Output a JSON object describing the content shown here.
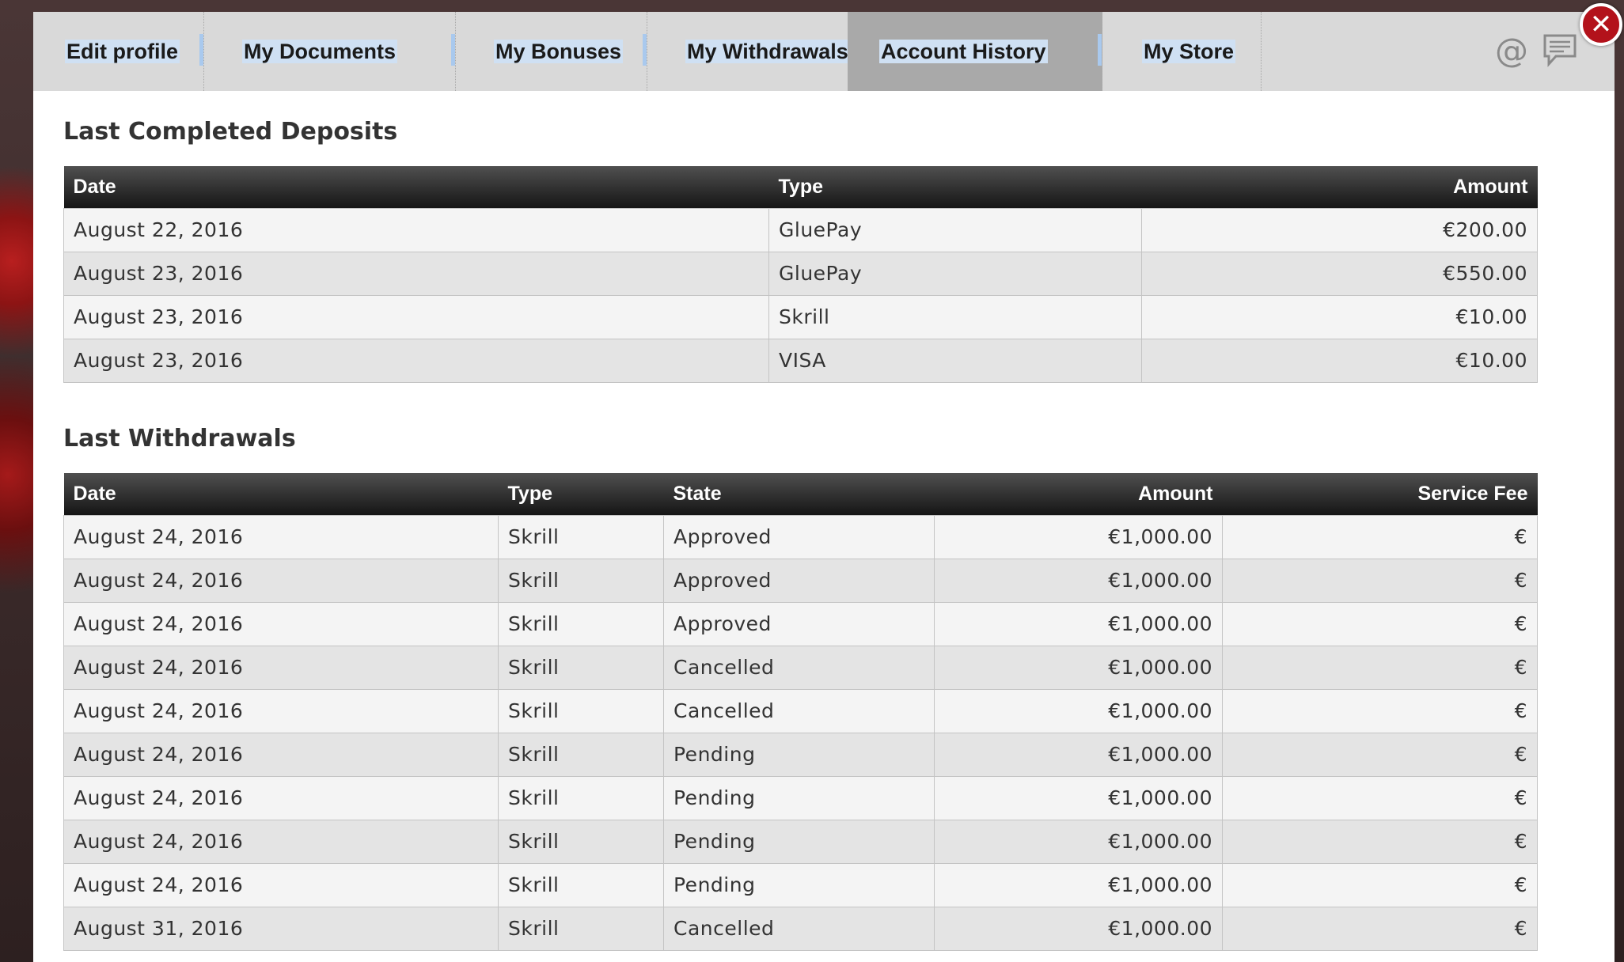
{
  "tabs": [
    {
      "label": "Edit profile",
      "active": false
    },
    {
      "label": "My Documents",
      "active": false
    },
    {
      "label": "My Bonuses",
      "active": false
    },
    {
      "label": "My Withdrawals",
      "active": false
    },
    {
      "label": "Account History",
      "active": true
    },
    {
      "label": "My Store",
      "active": false
    }
  ],
  "header_icons": {
    "at": "at-icon",
    "chat": "chat-bubble-icon",
    "close": "close-icon"
  },
  "deposits": {
    "title": "Last Completed Deposits",
    "columns": [
      "Date",
      "Type",
      "Amount"
    ],
    "rows": [
      {
        "date": "August 22, 2016",
        "type": "GluePay",
        "amount": "€200.00"
      },
      {
        "date": "August 23, 2016",
        "type": "GluePay",
        "amount": "€550.00"
      },
      {
        "date": "August 23, 2016",
        "type": "Skrill",
        "amount": "€10.00"
      },
      {
        "date": "August 23, 2016",
        "type": "VISA",
        "amount": "€10.00"
      }
    ]
  },
  "withdrawals": {
    "title": "Last Withdrawals",
    "columns": [
      "Date",
      "Type",
      "State",
      "Amount",
      "Service Fee"
    ],
    "rows": [
      {
        "date": "August 24, 2016",
        "type": "Skrill",
        "state": "Approved",
        "amount": "€1,000.00",
        "fee": "€"
      },
      {
        "date": "August 24, 2016",
        "type": "Skrill",
        "state": "Approved",
        "amount": "€1,000.00",
        "fee": "€"
      },
      {
        "date": "August 24, 2016",
        "type": "Skrill",
        "state": "Approved",
        "amount": "€1,000.00",
        "fee": "€"
      },
      {
        "date": "August 24, 2016",
        "type": "Skrill",
        "state": "Cancelled",
        "amount": "€1,000.00",
        "fee": "€"
      },
      {
        "date": "August 24, 2016",
        "type": "Skrill",
        "state": "Cancelled",
        "amount": "€1,000.00",
        "fee": "€"
      },
      {
        "date": "August 24, 2016",
        "type": "Skrill",
        "state": "Pending",
        "amount": "€1,000.00",
        "fee": "€"
      },
      {
        "date": "August 24, 2016",
        "type": "Skrill",
        "state": "Pending",
        "amount": "€1,000.00",
        "fee": "€"
      },
      {
        "date": "August 24, 2016",
        "type": "Skrill",
        "state": "Pending",
        "amount": "€1,000.00",
        "fee": "€"
      },
      {
        "date": "August 24, 2016",
        "type": "Skrill",
        "state": "Pending",
        "amount": "€1,000.00",
        "fee": "€"
      },
      {
        "date": "August 31, 2016",
        "type": "Skrill",
        "state": "Cancelled",
        "amount": "€1,000.00",
        "fee": "€"
      }
    ]
  }
}
